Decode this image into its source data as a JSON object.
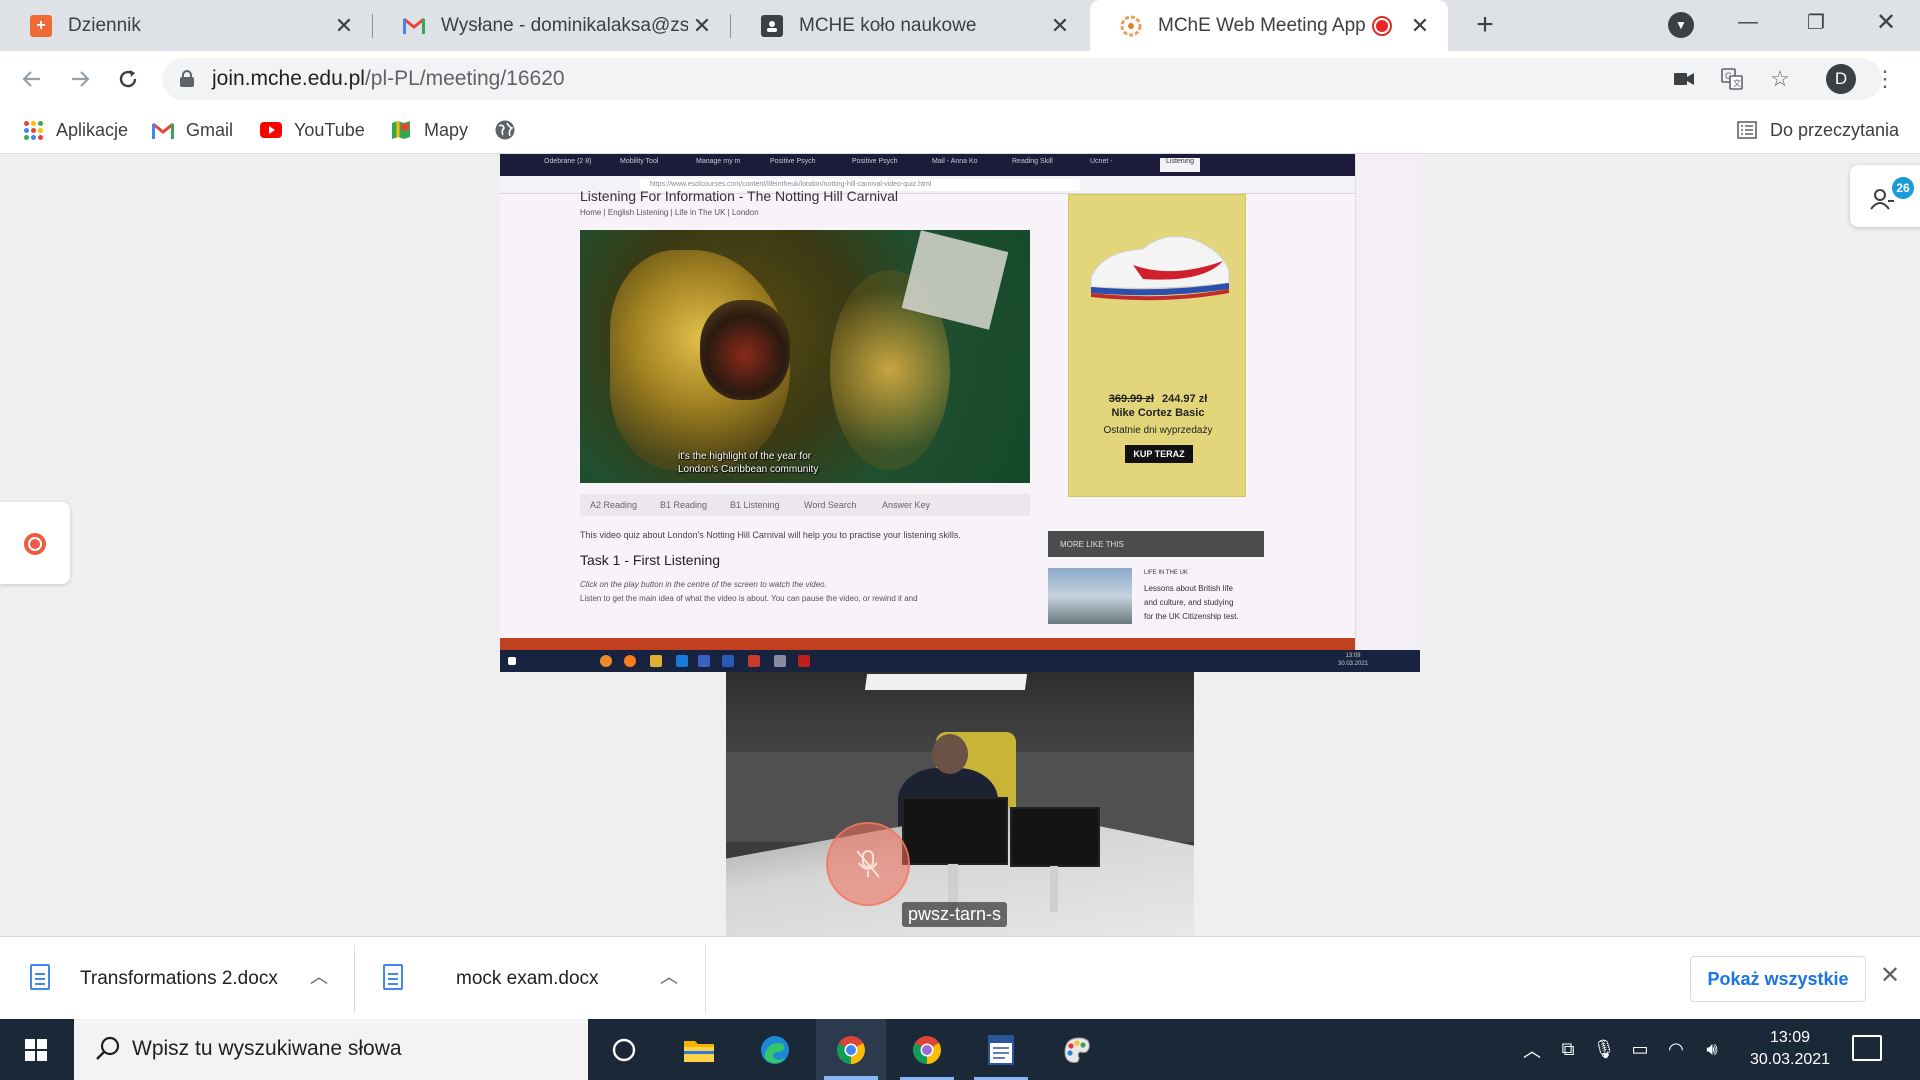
{
  "browser": {
    "tabs": [
      {
        "title": "Dziennik",
        "favicon": "dziennik-icon",
        "color": "#f06a35"
      },
      {
        "title": "Wysłane - dominikalaksa@zswoli",
        "favicon": "gmail-icon",
        "color": "#ea4335"
      },
      {
        "title": "MCHE koło naukowe",
        "favicon": "contact-card-icon",
        "color": "#3c4043"
      },
      {
        "title": "MChE Web Meeting App",
        "favicon": "meeting-app-icon",
        "color": "#e8a060",
        "active": true,
        "recording": true
      }
    ],
    "url_host": "join.mche.edu.pl",
    "url_path": "/pl-PL/meeting/16620",
    "profile_initial": "D",
    "bookmarks": [
      {
        "label": "Aplikacje",
        "icon": "apps-grid-icon"
      },
      {
        "label": "Gmail",
        "icon": "gmail-icon"
      },
      {
        "label": "YouTube",
        "icon": "youtube-icon"
      },
      {
        "label": "Mapy",
        "icon": "maps-icon"
      },
      {
        "label": "",
        "icon": "globe-icon"
      }
    ],
    "reading_list": "Do przeczytania"
  },
  "meeting": {
    "participants_count": "26",
    "camera_label": "pwsz-tarn-s",
    "shared_page": {
      "inner_tabs": [
        "Odebrane (2 8)",
        "Mobility Tool",
        "Manage my m",
        "Positive Psych",
        "Positive Psych",
        "Mail - Anna Ko",
        "Reading Skill",
        "Ucnet -",
        "Listening"
      ],
      "inner_url": "https://www.esolcourses.com/content/lifeintheuk/london/notting-hill-carnival-video-quiz.html",
      "heading": "Listening For Information - The Notting Hill Carnival",
      "breadcrumbs": "Home | English Listening | Life in The UK | London",
      "subtitle_line1": "it's the highlight of the year for",
      "subtitle_line2": "London's Caribbean community",
      "tabs": [
        "A2 Reading",
        "B1 Reading",
        "B1 Listening",
        "Word Search",
        "Answer Key"
      ],
      "intro": "This video quiz about London's Notting Hill Carnival will help you to practise your listening skills.",
      "task_title": "Task 1 - First Listening",
      "task_click": "Click on the play button in the centre of the screen to watch the video.",
      "task_listen": "Listen to get the main idea of what the video is about. You can pause the video, or rewind it and",
      "ad": {
        "old_price": "369.99 zł",
        "new_price": "244.97 zł",
        "product": "Nike Cortez Basic",
        "tagline": "Ostatnie dni wyprzedaży",
        "cta": "KUP TERAZ"
      },
      "more_like_this": "MORE LIKE THIS",
      "more_category": "LIFE IN THE UK",
      "more_text": "Lessons about British life and culture, and studying for the UK Citizenship test.",
      "inner_clock_time": "13:09",
      "inner_clock_date": "30.03.2021"
    }
  },
  "downloads": {
    "items": [
      "Transformations 2.docx",
      "mock exam.docx"
    ],
    "show_all": "Pokaż wszystkie"
  },
  "taskbar": {
    "search_placeholder": "Wpisz tu wyszukiwane słowa",
    "apps": [
      "cortana-icon",
      "file-explorer-icon",
      "edge-icon",
      "chrome-icon",
      "chrome-alt-icon",
      "notepad-icon",
      "paint-icon"
    ],
    "time": "13:09",
    "date": "30.03.2021"
  }
}
